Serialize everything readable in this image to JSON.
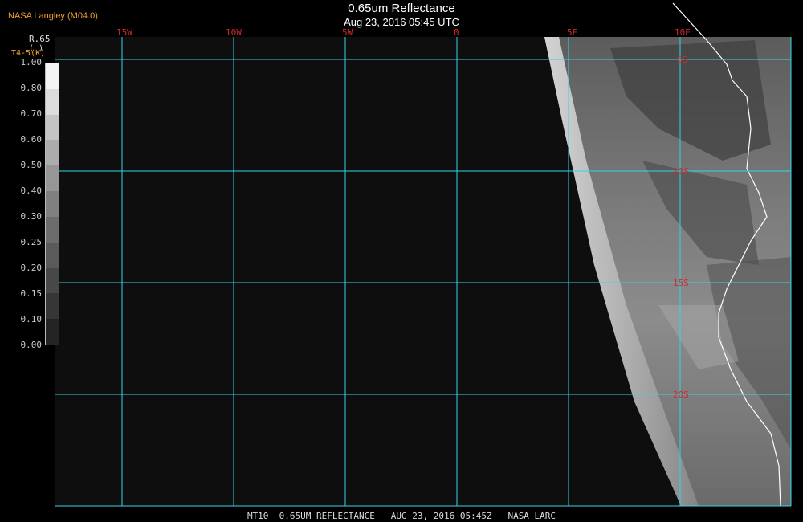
{
  "header": {
    "credit": "NASA Langley (M04.0)",
    "title": "0.65um Reflectance",
    "subtitle": "Aug 23, 2016 05:45 UTC"
  },
  "legend": {
    "title_line1": "R.65",
    "title_line2": "( )",
    "title_line3": "T4-5(K)",
    "ticks": [
      "1.00",
      "0.80",
      "0.70",
      "0.60",
      "0.50",
      "0.40",
      "0.30",
      "0.25",
      "0.20",
      "0.15",
      "0.10",
      "0.00"
    ],
    "colors": [
      "#f4f4f4",
      "#dcdcdc",
      "#c4c4c4",
      "#acacac",
      "#969696",
      "#808080",
      "#6c6c6c",
      "#5a5a5a",
      "#484848",
      "#363636",
      "#242424"
    ]
  },
  "map": {
    "longitude_labels": [
      "15W",
      "10W",
      "5W",
      "0",
      "5E",
      "10E"
    ],
    "latitude_labels": [
      "5S",
      "10S",
      "15S",
      "20S"
    ],
    "grid_color": "#37d3e6",
    "label_color": "#d22a2a"
  },
  "footer": {
    "caption": "MT10  0.65UM REFLECTANCE   AUG 23, 2016 05:45Z   NASA LARC"
  }
}
